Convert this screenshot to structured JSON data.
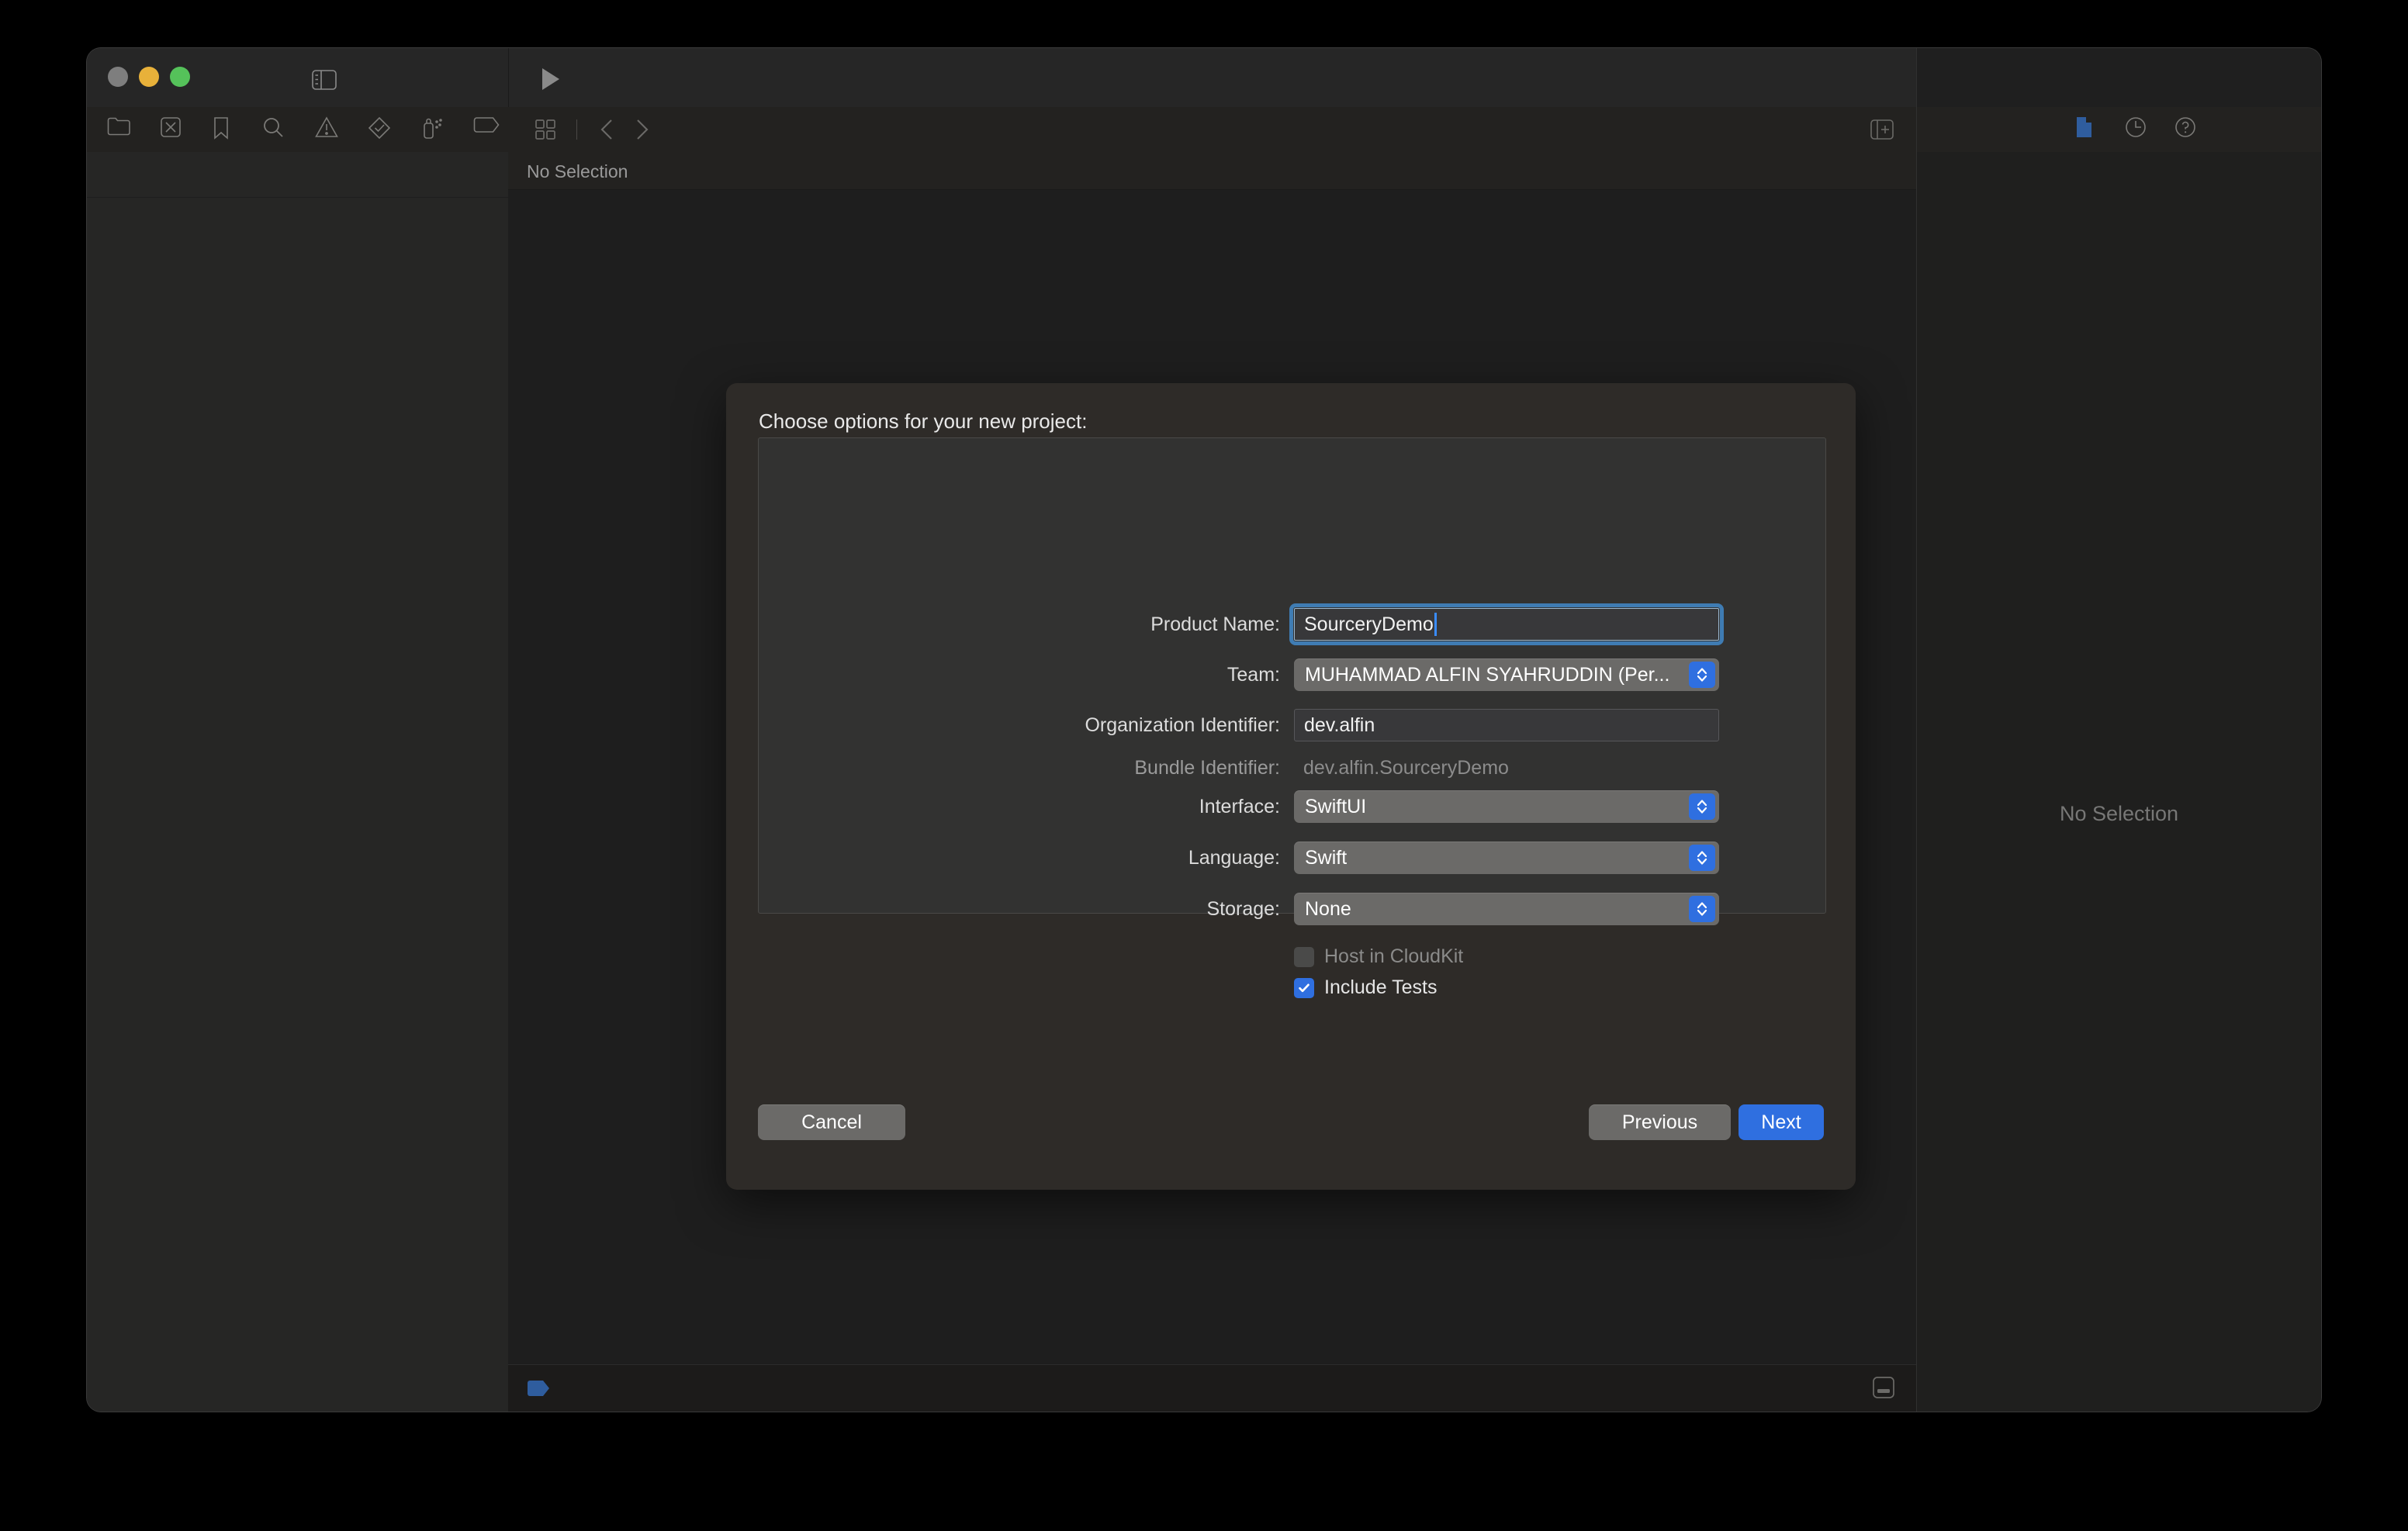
{
  "window": {
    "traffic_lights": [
      "close",
      "minimize",
      "maximize"
    ],
    "titlebar": {
      "sidebar_toggle_icon": "sidebar-left-icon",
      "run_icon": "run-triangle-icon",
      "activity_view_text": "",
      "add_icon": "plus-icon",
      "inspector_toggle_icon": "sidebar-right-icon"
    },
    "navigator_toolbar": {
      "icons": [
        "folder-project-navigator-icon",
        "source-control-navigator-icon",
        "bookmark-navigator-icon",
        "search-navigator-icon",
        "issue-navigator-icon",
        "test-navigator-icon",
        "debug-navigator-icon",
        "breakpoint-navigator-icon",
        "report-navigator-icon"
      ]
    },
    "jump_bar": {
      "editor_options_icon": "editor-options-grid-icon",
      "back_icon": "chevron-left-icon",
      "forward_icon": "chevron-right-icon",
      "add_editor_icon": "add-editor-icon"
    },
    "inspector_toolbar": {
      "icons": [
        "file-inspector-icon",
        "history-inspector-icon",
        "quick-help-inspector-icon"
      ]
    },
    "editor": {
      "breadcrumb_text": "No Selection"
    },
    "inspector": {
      "empty_text": "No Selection"
    },
    "status_bar": {
      "left_icon": "tag-label-icon",
      "right_icon": "show-debug-area-icon"
    }
  },
  "sheet": {
    "title": "Choose options for your new project:",
    "fields": [
      {
        "label": "Product Name:",
        "value": "SourceryDemo",
        "type": "textfield",
        "focused": true
      },
      {
        "label": "Team:",
        "value": "MUHAMMAD ALFIN SYAHRUDDIN (Per...",
        "type": "popup"
      },
      {
        "label": "Organization Identifier:",
        "value": "dev.alfin",
        "type": "textfield",
        "focused": false
      },
      {
        "label": "Bundle Identifier:",
        "value": "dev.alfin.SourceryDemo",
        "type": "static"
      },
      {
        "label": "Interface:",
        "value": "SwiftUI",
        "type": "popup"
      },
      {
        "label": "Language:",
        "value": "Swift",
        "type": "popup"
      },
      {
        "label": "Storage:",
        "value": "None",
        "type": "popup"
      }
    ],
    "checkboxes": [
      {
        "label": "Host in CloudKit",
        "checked": false,
        "enabled": false
      },
      {
        "label": "Include Tests",
        "checked": true,
        "enabled": true
      }
    ],
    "buttons": {
      "cancel": "Cancel",
      "previous": "Previous",
      "next": "Next"
    }
  },
  "colors": {
    "accent_blue": "#2f6fe0",
    "focus_ring": "#3f7cb3",
    "sheet_bg": "#2e2b28",
    "window_bg": "#232323"
  }
}
